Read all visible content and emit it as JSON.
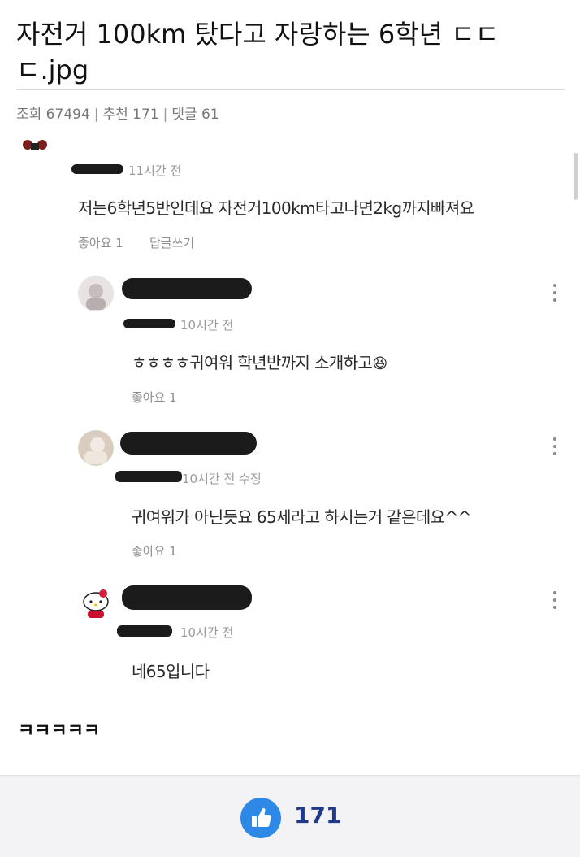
{
  "post": {
    "title": "자전거 100km 탔다고 자랑하는 6학년 ㄷㄷㄷ.jpg",
    "views_label": "조회 67494",
    "recommend_label": "추천 171",
    "comments_label": "댓글 61",
    "separator": "|"
  },
  "comments": [
    {
      "time": "11시간 전",
      "text": "저는6학년5반인데요 자전거100km타고나면2kg까지빠져요",
      "like": "좋아요 1",
      "reply": "답글쓰기"
    },
    {
      "time": "10시간 전",
      "text": "ㅎㅎㅎㅎ귀여워 학년반까지 소개하고",
      "emoji": "😆",
      "like": "좋아요 1"
    },
    {
      "time": "10시간 전 수정",
      "text": "귀여워가 아닌듯요 65세라고 하시는거 같은데요^^",
      "like": "좋아요 1"
    },
    {
      "time": "10시간 전",
      "text": "네65입니다"
    }
  ],
  "body_text": "ㅋㅋㅋㅋㅋ",
  "footer": {
    "like_count": "171"
  },
  "colors": {
    "accent": "#2e89e6",
    "count": "#1f3a8a"
  },
  "icons": [
    "more-vert-icon",
    "thumbs-up-icon"
  ]
}
